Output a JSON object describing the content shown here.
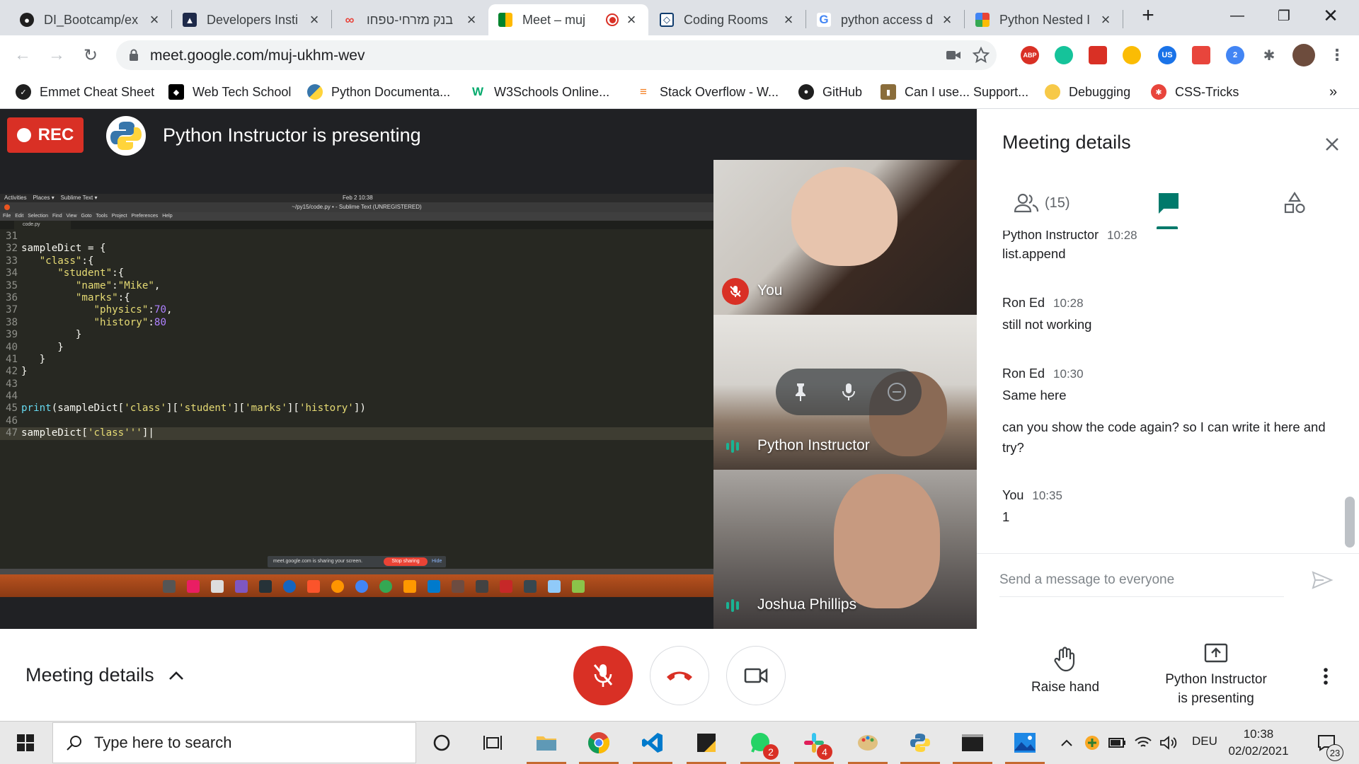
{
  "browser": {
    "tabs": [
      {
        "title": "DI_Bootcamp/ex",
        "icon": "github-icon"
      },
      {
        "title": "Developers Insti",
        "icon": "graduation-cap-icon"
      },
      {
        "title": "בנק מזרחי-טפחו",
        "icon": "infinity-icon"
      },
      {
        "title": "Meet – muj",
        "icon": "google-meet-icon",
        "active": true,
        "recording": true
      },
      {
        "title": "Coding Rooms",
        "icon": "coding-rooms-icon"
      },
      {
        "title": "python access d",
        "icon": "google-icon"
      },
      {
        "title": "Python Nested I",
        "icon": "python-icon"
      }
    ],
    "url": "meet.google.com/muj-ukhm-wev",
    "extensions": [
      {
        "label": "ABP",
        "color": "#d93025"
      },
      {
        "label": "",
        "color": "#15c39a"
      },
      {
        "label": "",
        "color": "#d93025"
      },
      {
        "label": "",
        "color": "#fbbc04"
      },
      {
        "label": "US",
        "color": "#1a73e8"
      },
      {
        "label": "",
        "color": "#e8453c"
      },
      {
        "label": "2",
        "color": "#4285f4"
      }
    ],
    "bookmarks": [
      {
        "label": "Emmet Cheat Sheet",
        "icon": "emmet-icon",
        "color": "#1f1f1f"
      },
      {
        "label": "Web Tech School",
        "icon": "web-tech-icon",
        "color": "#000000"
      },
      {
        "label": "Python Documenta...",
        "icon": "python-icon",
        "color": "#3776ab"
      },
      {
        "label": "W3Schools Online...",
        "icon": "w3schools-icon",
        "color": "#04aa6d"
      },
      {
        "label": "Stack Overflow - W...",
        "icon": "stackoverflow-icon",
        "color": "#f48024"
      },
      {
        "label": "GitHub",
        "icon": "github-icon",
        "color": "#1f1f1f"
      },
      {
        "label": "Can I use... Support...",
        "icon": "caniuse-icon",
        "color": "#8a6d3b"
      },
      {
        "label": "Debugging",
        "icon": "duck-icon",
        "color": "#f7c948"
      },
      {
        "label": "CSS-Tricks",
        "icon": "css-tricks-icon",
        "color": "#e8453c"
      }
    ],
    "bookmarks_more": "»"
  },
  "meet": {
    "rec_label": "REC",
    "presenting_title": "Python Instructor is presenting",
    "shared_screen": {
      "topbar_left": "Activities    Places ▾    Sublime Text ▾",
      "topbar_clock": "Feb 2  10:38",
      "title": "~/py15/code.py • - Sublime Text (UNREGISTERED)",
      "menu": "File Edit Selection Find View Goto Tools Project Preferences Help",
      "tab": "code.py",
      "sharing_notice": "meet.google.com is sharing your screen.",
      "stop_sharing": "Stop sharing",
      "hide": "Hide"
    },
    "participants_tiles": [
      {
        "name": "You",
        "muted": true
      },
      {
        "name": "Python Instructor",
        "speaking": true
      },
      {
        "name": "Joshua Phillips",
        "speaking": true
      }
    ],
    "controls": {
      "meeting_details": "Meeting details",
      "raise_hand": "Raise hand",
      "presenting_line1": "Python Instructor",
      "presenting_line2": "is presenting"
    }
  },
  "panel": {
    "title": "Meeting details",
    "people_count": "(15)",
    "messages": [
      {
        "sender": "Python Instructor",
        "time": "10:28",
        "lines": [
          "list.append"
        ]
      },
      {
        "sender": "Ron Ed",
        "time": "10:28",
        "lines": [
          "still not working"
        ]
      },
      {
        "sender": "Ron Ed",
        "time": "10:30",
        "lines": [
          "Same here",
          "can you show the code again? so I can write it here and try?"
        ]
      },
      {
        "sender": "You",
        "time": "10:35",
        "lines": [
          "1"
        ]
      }
    ],
    "composer_placeholder": "Send a message to everyone"
  },
  "taskbar": {
    "search_placeholder": "Type here to search",
    "language": "DEU",
    "time": "10:38",
    "date": "02/02/2021",
    "notifications": "23",
    "whatsapp_badge": "2",
    "slack_badge": "4"
  },
  "colors": {
    "meet_red": "#d93025",
    "meet_teal": "#00796b",
    "sublime_bg": "#272822"
  }
}
